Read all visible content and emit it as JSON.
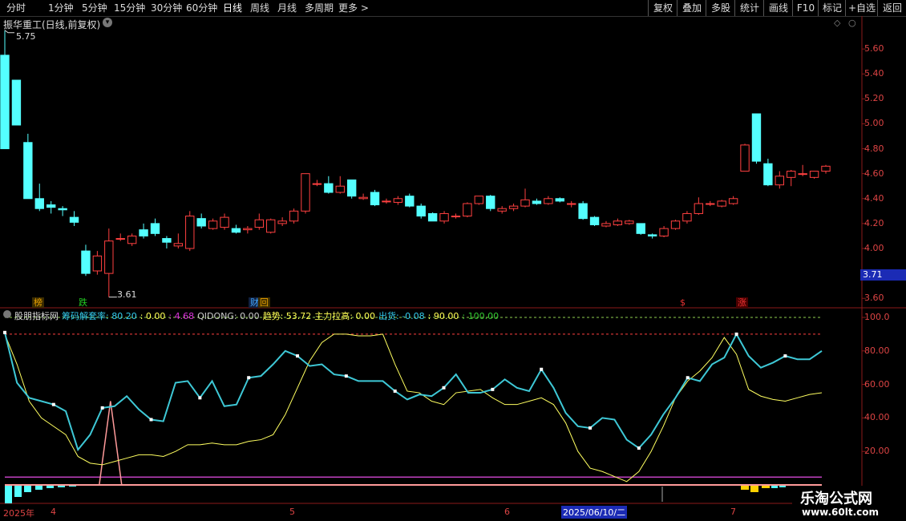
{
  "toolbar": {
    "periods": [
      "分时",
      "1分钟",
      "5分钟",
      "15分钟",
      "30分钟",
      "60分钟",
      "日线",
      "周线",
      "月线",
      "多周期",
      "更多"
    ],
    "more_arrow": ">",
    "actions": [
      "复权",
      "叠加",
      "多股",
      "统计",
      "画线",
      "F10",
      "标记",
      "+自选",
      "返回"
    ]
  },
  "stock": {
    "title": "振华重工(日线,前复权)",
    "high_label": "5.75",
    "low_label": "3.61",
    "current_price_tag": "3.71"
  },
  "price_axis": [
    "5.60",
    "5.40",
    "5.20",
    "5.00",
    "4.80",
    "4.60",
    "4.40",
    "4.20",
    "4.00",
    "3.80",
    "3.60"
  ],
  "event_badges": [
    {
      "text": "榜",
      "color": "#e8a000"
    },
    {
      "text": "跌",
      "color": "#2c2"
    },
    {
      "text": "财",
      "color": "#4af"
    },
    {
      "text": "回",
      "color": "#e8a000"
    },
    {
      "text": "$",
      "color": "#e33"
    },
    {
      "text": "涨",
      "color": "#e33"
    }
  ],
  "indicator": {
    "name": "股朋指标网",
    "legend": [
      {
        "text": "筹码解套率: 80.20",
        "color": "#3ce"
      },
      {
        "text": ": 0.00",
        "color": "#ff5"
      },
      {
        "text": ": 4.68",
        "color": "#d3d"
      },
      {
        "text": "QIDONG: 0.00",
        "color": "#ccc"
      },
      {
        "text": "趋势: 53.72",
        "color": "#ff5"
      },
      {
        "text": "主力拉高: 0.00",
        "color": "#ff5"
      },
      {
        "text": "出货: -0.08",
        "color": "#3ce"
      },
      {
        "text": ": 90.00",
        "color": "#ff5"
      },
      {
        "text": ": 100.00",
        "color": "#3c3"
      }
    ],
    "axis": [
      "100.0",
      "80.00",
      "60.00",
      "40.00",
      "20.00"
    ]
  },
  "date_axis": {
    "labels": [
      "2025年",
      "4",
      "5",
      "6",
      "2025/06/10/二",
      "7"
    ]
  },
  "watermark": {
    "line1": "乐淘公式网",
    "line2": "www.60lt.com"
  },
  "colors": {
    "up": "#ff4040",
    "down": "#54ffff",
    "main_line": "#3ec8d6",
    "trend_line": "#ffff60",
    "dash_red": "#ff4040",
    "dash_green": "#8fd14f",
    "magenta": "#c040c0"
  },
  "chart_data": {
    "type": "candlestick",
    "candles": [
      [
        5.55,
        4.8,
        5.75,
        4.8
      ],
      [
        5.35,
        4.99,
        5.35,
        4.99
      ],
      [
        4.85,
        4.4,
        4.92,
        4.4
      ],
      [
        4.4,
        4.32,
        4.52,
        4.3
      ],
      [
        4.35,
        4.33,
        4.38,
        4.28
      ],
      [
        4.32,
        4.31,
        4.34,
        4.26
      ],
      [
        4.25,
        4.21,
        4.3,
        4.18
      ],
      [
        3.98,
        3.8,
        4.03,
        3.78
      ],
      [
        3.82,
        3.94,
        3.98,
        3.79
      ],
      [
        3.8,
        4.06,
        4.16,
        3.61
      ],
      [
        4.08,
        4.08,
        4.12,
        4.06
      ],
      [
        4.04,
        4.1,
        4.12,
        4.02
      ],
      [
        4.15,
        4.1,
        4.2,
        4.08
      ],
      [
        4.2,
        4.12,
        4.24,
        4.1
      ],
      [
        4.08,
        4.05,
        4.1,
        4.0
      ],
      [
        4.02,
        4.04,
        4.12,
        4.0
      ],
      [
        4.0,
        4.26,
        4.3,
        3.98
      ],
      [
        4.24,
        4.18,
        4.28,
        4.16
      ],
      [
        4.16,
        4.22,
        4.24,
        4.15
      ],
      [
        4.17,
        4.25,
        4.28,
        4.15
      ],
      [
        4.16,
        4.13,
        4.19,
        4.12
      ],
      [
        4.15,
        4.16,
        4.18,
        4.12
      ],
      [
        4.17,
        4.23,
        4.28,
        4.15
      ],
      [
        4.13,
        4.23,
        4.24,
        4.12
      ],
      [
        4.2,
        4.22,
        4.25,
        4.18
      ],
      [
        4.22,
        4.3,
        4.32,
        4.2
      ],
      [
        4.3,
        4.6,
        4.6,
        4.28
      ],
      [
        4.52,
        4.52,
        4.55,
        4.5
      ],
      [
        4.52,
        4.45,
        4.58,
        4.44
      ],
      [
        4.45,
        4.5,
        4.58,
        4.44
      ],
      [
        4.55,
        4.42,
        4.55,
        4.4
      ],
      [
        4.4,
        4.41,
        4.44,
        4.39
      ],
      [
        4.45,
        4.35,
        4.47,
        4.34
      ],
      [
        4.38,
        4.38,
        4.4,
        4.36
      ],
      [
        4.37,
        4.4,
        4.42,
        4.35
      ],
      [
        4.42,
        4.34,
        4.44,
        4.33
      ],
      [
        4.34,
        4.26,
        4.36,
        4.24
      ],
      [
        4.28,
        4.22,
        4.29,
        4.22
      ],
      [
        4.22,
        4.28,
        4.3,
        4.2
      ],
      [
        4.26,
        4.26,
        4.28,
        4.24
      ],
      [
        4.26,
        4.36,
        4.37,
        4.25
      ],
      [
        4.36,
        4.42,
        4.42,
        4.35
      ],
      [
        4.42,
        4.32,
        4.43,
        4.3
      ],
      [
        4.3,
        4.32,
        4.34,
        4.28
      ],
      [
        4.32,
        4.34,
        4.36,
        4.3
      ],
      [
        4.34,
        4.39,
        4.48,
        4.33
      ],
      [
        4.38,
        4.36,
        4.4,
        4.35
      ],
      [
        4.36,
        4.4,
        4.42,
        4.35
      ],
      [
        4.4,
        4.38,
        4.41,
        4.37
      ],
      [
        4.36,
        4.36,
        4.38,
        4.33
      ],
      [
        4.36,
        4.24,
        4.38,
        4.23
      ],
      [
        4.25,
        4.19,
        4.26,
        4.18
      ],
      [
        4.18,
        4.2,
        4.22,
        4.17
      ],
      [
        4.19,
        4.22,
        4.24,
        4.18
      ],
      [
        4.2,
        4.22,
        4.23,
        4.19
      ],
      [
        4.2,
        4.12,
        4.2,
        4.11
      ],
      [
        4.11,
        4.1,
        4.12,
        4.08
      ],
      [
        4.1,
        4.16,
        4.18,
        4.09
      ],
      [
        4.16,
        4.22,
        4.23,
        4.15
      ],
      [
        4.22,
        4.28,
        4.3,
        4.2
      ],
      [
        4.28,
        4.36,
        4.41,
        4.27
      ],
      [
        4.36,
        4.36,
        4.38,
        4.34
      ],
      [
        4.34,
        4.38,
        4.39,
        4.33
      ],
      [
        4.36,
        4.4,
        4.42,
        4.35
      ],
      [
        4.62,
        4.83,
        4.84,
        4.62
      ],
      [
        5.08,
        4.7,
        5.08,
        4.68
      ],
      [
        4.68,
        4.51,
        4.72,
        4.5
      ],
      [
        4.51,
        4.58,
        4.62,
        4.48
      ],
      [
        4.57,
        4.62,
        4.63,
        4.5
      ],
      [
        4.6,
        4.6,
        4.67,
        4.58
      ],
      [
        4.57,
        4.62,
        4.62,
        4.56
      ],
      [
        4.62,
        4.66,
        4.67,
        4.6
      ]
    ],
    "indicator_series": [
      {
        "name": "筹码解套率",
        "values": [
          91,
          61,
          52,
          50,
          48,
          44,
          21,
          30,
          46,
          47,
          53,
          45,
          39,
          38,
          61,
          62,
          52,
          62,
          47,
          48,
          64,
          65,
          72,
          80,
          77,
          71,
          72,
          66,
          65,
          62,
          62,
          62,
          56,
          51,
          54,
          53,
          58,
          66,
          55,
          55,
          57,
          63,
          58,
          56,
          69,
          58,
          43,
          35,
          34,
          40,
          39,
          27,
          22,
          30,
          42,
          52,
          64,
          62,
          72,
          76,
          90,
          77,
          70,
          73,
          77,
          75,
          75,
          80
        ]
      },
      {
        "name": "趋势",
        "values": [
          90,
          72,
          50,
          40,
          35,
          30,
          17,
          13,
          12,
          14,
          16,
          18,
          18,
          17,
          20,
          24,
          24,
          25,
          24,
          24,
          26,
          27,
          30,
          42,
          58,
          74,
          85,
          90,
          90,
          89,
          89,
          90,
          72,
          56,
          55,
          50,
          48,
          55,
          56,
          57,
          52,
          48,
          48,
          50,
          52,
          48,
          37,
          20,
          10,
          8,
          5,
          2,
          8,
          20,
          35,
          52,
          62,
          68,
          76,
          88,
          78,
          57,
          53,
          51,
          50,
          52,
          54,
          55
        ]
      }
    ],
    "spike": {
      "x_index": 9,
      "value": 50
    },
    "y_ranges": {
      "price": [
        3.55,
        5.8
      ],
      "indicator": [
        0,
        100
      ]
    }
  }
}
